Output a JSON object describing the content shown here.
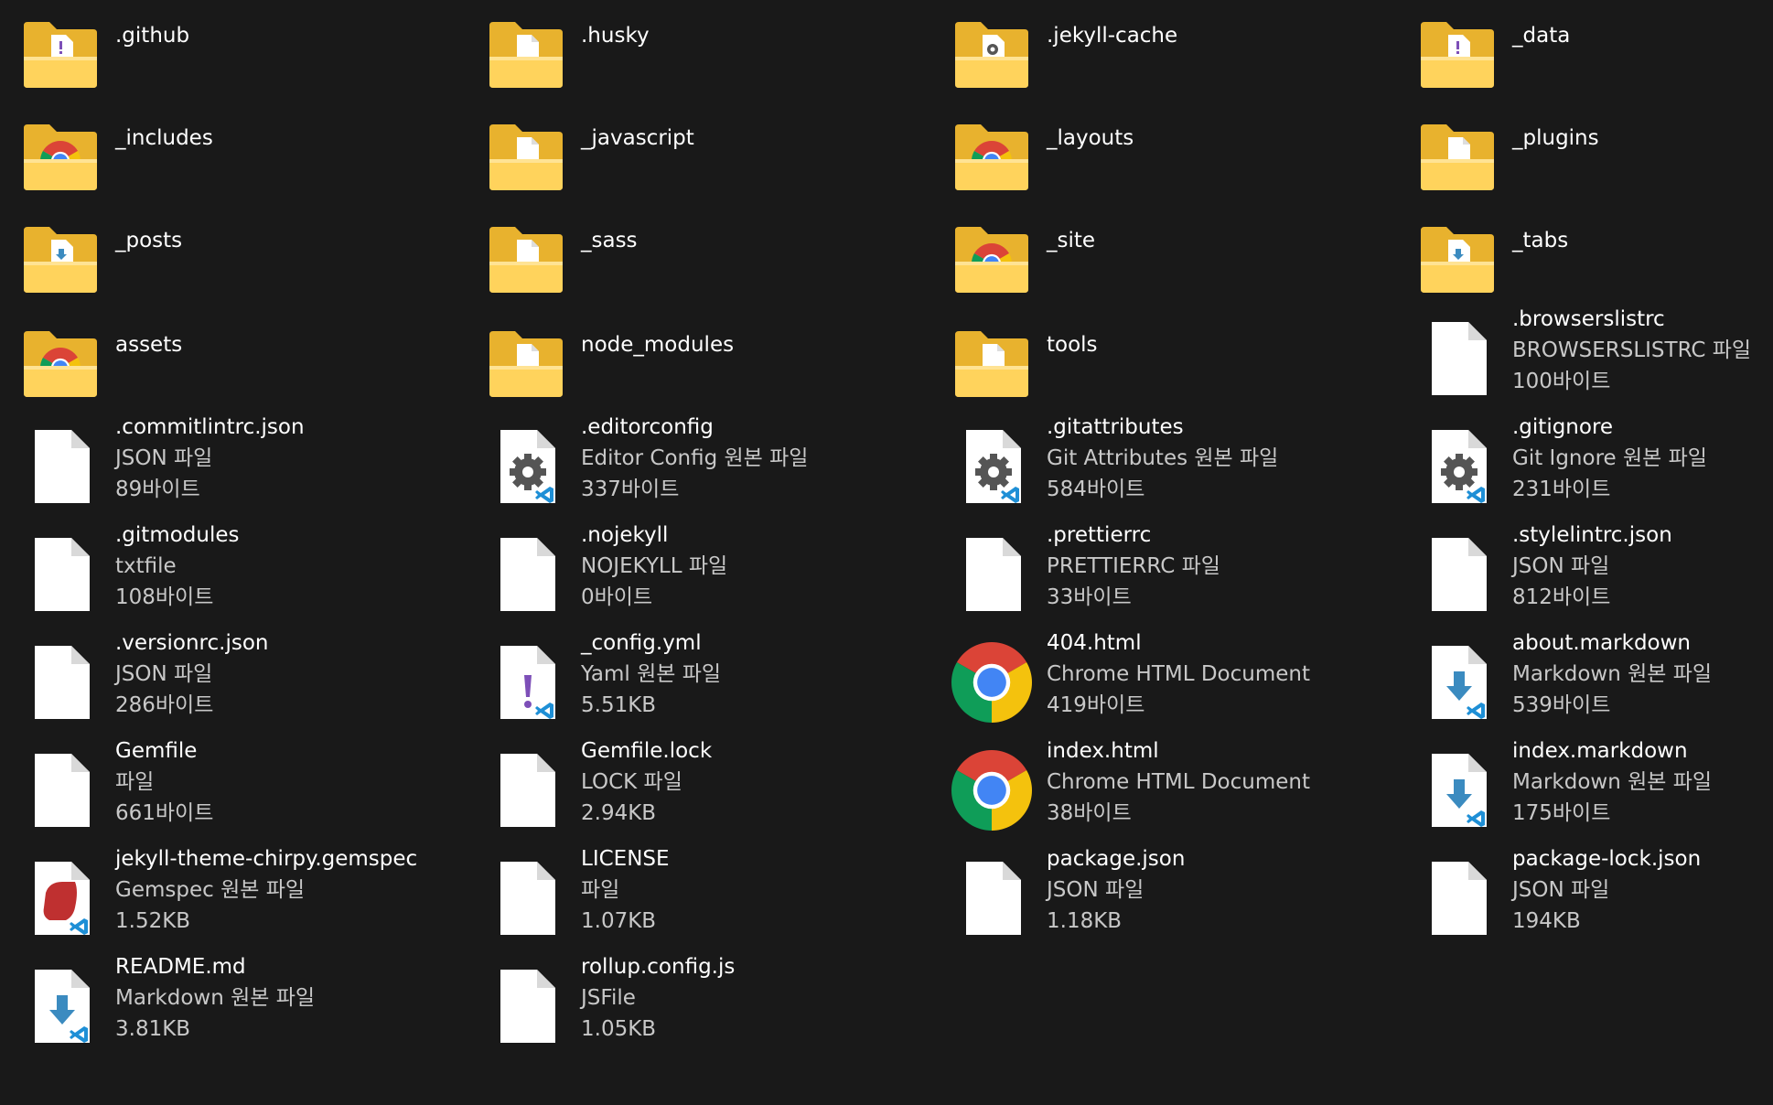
{
  "items": [
    {
      "name": ".github",
      "icon": "folder-icon",
      "overlay": "exclaim"
    },
    {
      "name": ".husky",
      "icon": "folder-icon",
      "overlay": "doc"
    },
    {
      "name": ".jekyll-cache",
      "icon": "folder-icon",
      "overlay": "gear"
    },
    {
      "name": "_data",
      "icon": "folder-icon",
      "overlay": "exclaim"
    },
    {
      "name": "_includes",
      "icon": "folder-icon",
      "overlay": "chrome"
    },
    {
      "name": "_javascript",
      "icon": "folder-icon",
      "overlay": "doc"
    },
    {
      "name": "_layouts",
      "icon": "folder-icon",
      "overlay": "chrome"
    },
    {
      "name": "_plugins",
      "icon": "folder-icon",
      "overlay": "doc"
    },
    {
      "name": "_posts",
      "icon": "folder-icon",
      "overlay": "markdown"
    },
    {
      "name": "_sass",
      "icon": "folder-icon",
      "overlay": "doc"
    },
    {
      "name": "_site",
      "icon": "folder-icon",
      "overlay": "chrome"
    },
    {
      "name": "_tabs",
      "icon": "folder-icon",
      "overlay": "markdown"
    },
    {
      "name": "assets",
      "icon": "folder-icon",
      "overlay": "chrome"
    },
    {
      "name": "node_modules",
      "icon": "folder-icon",
      "overlay": "doc"
    },
    {
      "name": "tools",
      "icon": "folder-icon",
      "overlay": "doc"
    },
    {
      "name": ".browserslistrc",
      "icon": "file-icon",
      "type": "BROWSERSLISTRC 파일",
      "size": "100바이트"
    },
    {
      "name": ".commitlintrc.json",
      "icon": "file-icon",
      "type": "JSON 파일",
      "size": "89바이트"
    },
    {
      "name": ".editorconfig",
      "icon": "config-file-icon",
      "type": "Editor Config 원본 파일",
      "size": "337바이트"
    },
    {
      "name": ".gitattributes",
      "icon": "config-file-icon",
      "type": "Git Attributes 원본 파일",
      "size": "584바이트"
    },
    {
      "name": ".gitignore",
      "icon": "config-file-icon",
      "type": "Git Ignore 원본 파일",
      "size": "231바이트"
    },
    {
      "name": ".gitmodules",
      "icon": "file-icon",
      "type": "txtfile",
      "size": "108바이트"
    },
    {
      "name": ".nojekyll",
      "icon": "file-icon",
      "type": "NOJEKYLL 파일",
      "size": "0바이트"
    },
    {
      "name": ".prettierrc",
      "icon": "file-icon",
      "type": "PRETTIERRC 파일",
      "size": "33바이트"
    },
    {
      "name": ".stylelintrc.json",
      "icon": "file-icon",
      "type": "JSON 파일",
      "size": "812바이트"
    },
    {
      "name": ".versionrc.json",
      "icon": "file-icon",
      "type": "JSON 파일",
      "size": "286바이트"
    },
    {
      "name": "_config.yml",
      "icon": "yaml-file-icon",
      "type": "Yaml 원본 파일",
      "size": "5.51KB"
    },
    {
      "name": "404.html",
      "icon": "chrome-icon",
      "type": "Chrome HTML Document",
      "size": "419바이트"
    },
    {
      "name": "about.markdown",
      "icon": "markdown-file-icon",
      "type": "Markdown 원본 파일",
      "size": "539바이트"
    },
    {
      "name": "Gemfile",
      "icon": "file-icon",
      "type": "파일",
      "size": "661바이트"
    },
    {
      "name": "Gemfile.lock",
      "icon": "file-icon",
      "type": "LOCK 파일",
      "size": "2.94KB"
    },
    {
      "name": "index.html",
      "icon": "chrome-icon",
      "type": "Chrome HTML Document",
      "size": "38바이트"
    },
    {
      "name": "index.markdown",
      "icon": "markdown-file-icon",
      "type": "Markdown 원본 파일",
      "size": "175바이트"
    },
    {
      "name": "jekyll-theme-chirpy.gemspec",
      "icon": "gemspec-file-icon",
      "type": "Gemspec 원본 파일",
      "size": "1.52KB"
    },
    {
      "name": "LICENSE",
      "icon": "file-icon",
      "type": "파일",
      "size": "1.07KB"
    },
    {
      "name": "package.json",
      "icon": "file-icon",
      "type": "JSON 파일",
      "size": "1.18KB"
    },
    {
      "name": "package-lock.json",
      "icon": "file-icon",
      "type": "JSON 파일",
      "size": "194KB"
    },
    {
      "name": "README.md",
      "icon": "markdown-file-icon",
      "type": "Markdown 원본 파일",
      "size": "3.81KB"
    },
    {
      "name": "rollup.config.js",
      "icon": "file-icon",
      "type": "JSFile",
      "size": "1.05KB"
    }
  ],
  "colors": {
    "background": "#191919",
    "folder_back": "#e8b22e",
    "folder_front": "#ffd35c",
    "secondary_text": "#c8c8c8",
    "vscode_badge": "#1e8fd6"
  }
}
